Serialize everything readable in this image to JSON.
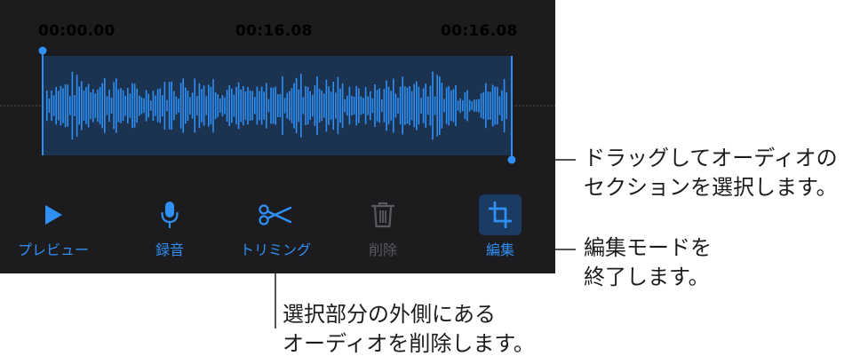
{
  "colors": {
    "panel_bg": "#1c1c1e",
    "accent": "#2f8ff5",
    "text_white": "#ffffff",
    "disabled": "#5a5a5e",
    "selection_bg": "#1b3350",
    "edit_active_bg": "#1b3b63",
    "callout_text": "#1c1c1e"
  },
  "timeline": {
    "start_time": "00:00.00",
    "current_time": "00:16.08",
    "end_time": "00:16.08"
  },
  "toolbar": {
    "preview": {
      "label": "プレビュー",
      "icon": "play-icon"
    },
    "record": {
      "label": "録音",
      "icon": "microphone-icon"
    },
    "trim": {
      "label": "トリミング",
      "icon": "scissors-icon"
    },
    "delete": {
      "label": "削除",
      "icon": "trash-icon",
      "disabled": true
    },
    "edit": {
      "label": "編集",
      "icon": "crop-icon",
      "active": true
    }
  },
  "callouts": {
    "drag": [
      "ドラッグしてオーディオの",
      "セクションを選択します。"
    ],
    "edit_mode": [
      "編集モードを",
      "終了します。"
    ],
    "trim": [
      "選択部分の外側にある",
      "オーディオを削除します。"
    ]
  }
}
